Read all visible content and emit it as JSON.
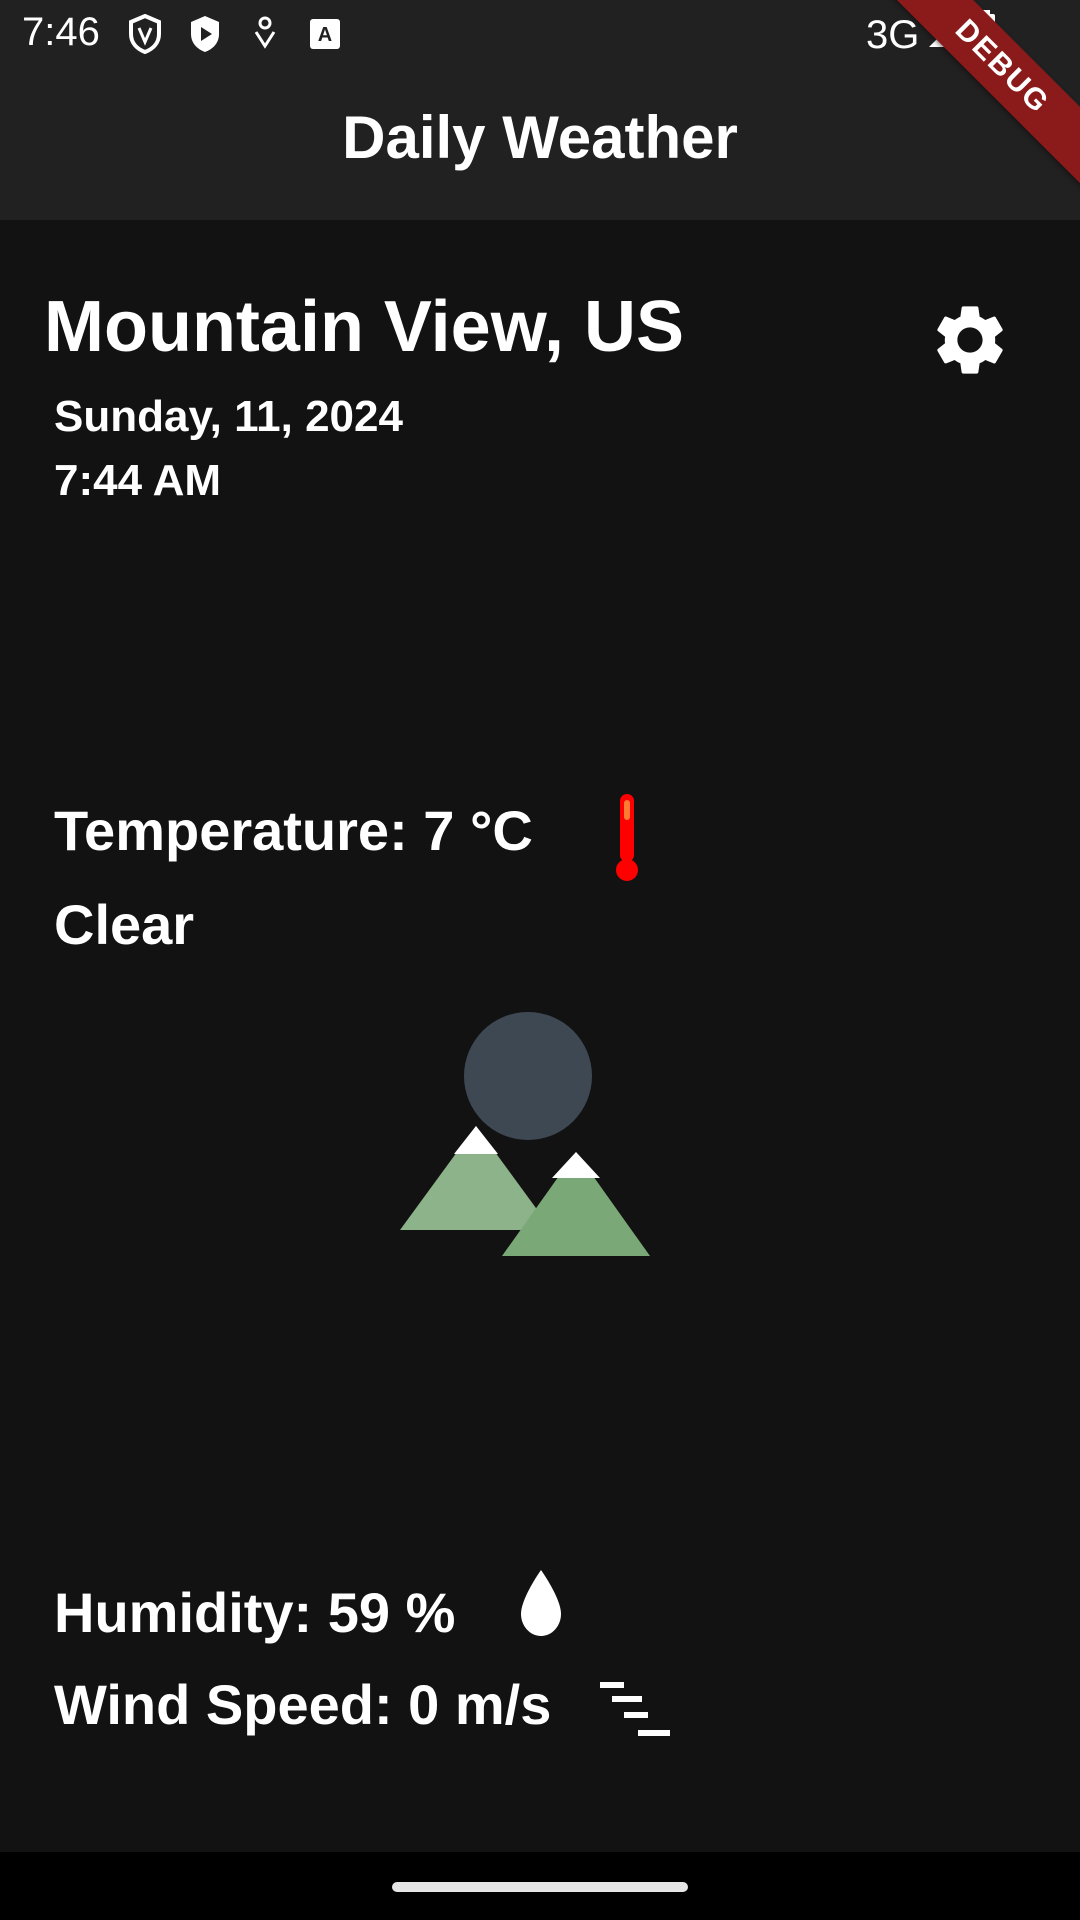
{
  "status_bar": {
    "time": "7:46",
    "network": "3G",
    "icons": [
      "vpn-shield-icon",
      "play-shield-icon",
      "accessibility-icon",
      "keyboard-a-icon",
      "signal-icon",
      "battery-charging-icon"
    ]
  },
  "app_bar": {
    "title": "Daily Weather"
  },
  "debug_banner": {
    "label": "DEBUG"
  },
  "location": {
    "city": "Mountain View, US",
    "date": "Sunday, 11, 2024",
    "time": "7:44 AM"
  },
  "weather": {
    "temperature": "Temperature: 7 °C",
    "condition": "Clear",
    "humidity": "Humidity: 59 %",
    "wind_speed": "Wind Speed: 0 m/s"
  },
  "colors": {
    "background": "#121212",
    "app_bar": "#212121",
    "thermometer": "#ff0000",
    "debug_banner": "#8b1a1a"
  }
}
